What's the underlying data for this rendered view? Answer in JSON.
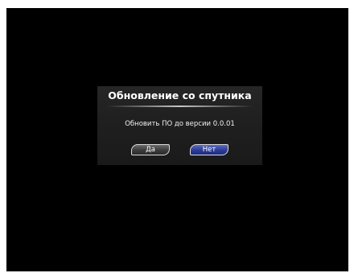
{
  "dialog": {
    "title": "Обновление со спутника",
    "message": "Обновить ПО до версии 0.0.01",
    "yes_label": "Да",
    "no_label": "Нет"
  },
  "colors": {
    "screen_background": "#000000",
    "dialog_background": "#222222",
    "selected_button": "#2d3c98",
    "unselected_button": "#3c3c3c"
  }
}
